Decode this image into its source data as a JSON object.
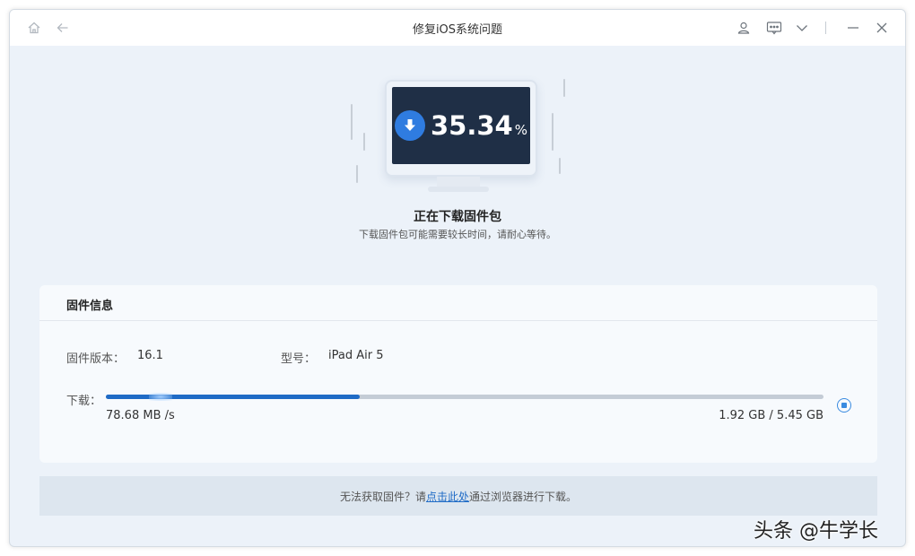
{
  "window": {
    "title": "修复iOS系统问题"
  },
  "titlebar_icons": {
    "home": "home-icon",
    "back": "back-arrow-icon",
    "user": "user-icon",
    "feedback": "feedback-icon",
    "menu": "chevron-down-icon",
    "minimize": "minimize-icon",
    "close": "close-icon"
  },
  "progress": {
    "percent_value": "35.34",
    "percent_sign": "%",
    "fraction": 0.3534
  },
  "status": {
    "title": "正在下载固件包",
    "subtitle": "下载固件包可能需要较长时间，请耐心等待。"
  },
  "firmware": {
    "header": "固件信息",
    "version_label": "固件版本：",
    "version_value": "16.1",
    "model_label": "型号：",
    "model_value": "iPad Air 5",
    "download_label": "下载：",
    "speed": "78.68 MB /s",
    "size": "1.92 GB / 5.45 GB"
  },
  "footer": {
    "before": "无法获取固件？请",
    "link": "点击此处",
    "after": "通过浏览器进行下载。"
  },
  "watermark": "头条 @牛学长",
  "colors": {
    "accent": "#1f6bc6",
    "screen": "#1f2f46",
    "background": "#ecf2f9"
  }
}
